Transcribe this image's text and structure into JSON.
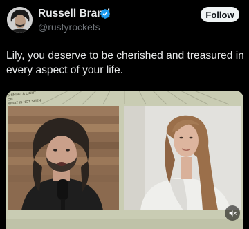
{
  "post": {
    "author": {
      "name": "Russell Brand",
      "handle": "@rustyrockets",
      "verified": true,
      "avatar_icon": "avatar-icon"
    },
    "follow_label": "Follow",
    "text_lines": [
      "Lily, you deserve to be cherished and treasured in",
      "every aspect of your life."
    ],
    "media": {
      "watermark_lines": [
        "SHINING A LIGHT ON",
        "WHAT IS NOT SEEN"
      ],
      "mute_icon": "speaker-muted-icon"
    }
  },
  "colors": {
    "background": "#000000",
    "text": "#e7e9ea",
    "secondary_text": "#71767b",
    "verified": "#1d9bf0",
    "follow_button": "#eff3f4"
  }
}
